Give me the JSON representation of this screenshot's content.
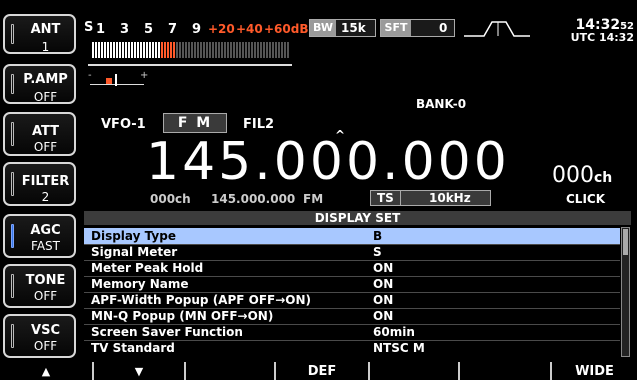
{
  "side_buttons": [
    {
      "name": "ANT",
      "value": "1",
      "active": false
    },
    {
      "name": "P.AMP",
      "value": "OFF",
      "active": false
    },
    {
      "name": "ATT",
      "value": "OFF",
      "active": false
    },
    {
      "name": "FILTER",
      "value": "2",
      "active": false
    },
    {
      "name": "AGC",
      "value": "FAST",
      "active": true
    },
    {
      "name": "TONE",
      "value": "OFF",
      "active": false
    },
    {
      "name": "VSC",
      "value": "OFF",
      "active": false
    }
  ],
  "meter": {
    "s_label": "S",
    "scale": [
      "1",
      "3",
      "5",
      "7",
      "9"
    ],
    "plus_scale": [
      "+20",
      "+40",
      "+60dB"
    ],
    "peak_level": 0.42
  },
  "bw": {
    "label": "BW",
    "value": "15k"
  },
  "sft": {
    "label": "SFT",
    "value": "0"
  },
  "clock": {
    "time": "14:32",
    "seconds": "52",
    "utc": "UTC 14:32"
  },
  "bank": "BANK-0",
  "vfo": "VFO-1",
  "mode": "F M",
  "filter": "FIL2",
  "frequency": "145.000.000",
  "channel": {
    "number": "000",
    "unit": "ch"
  },
  "sub_info": {
    "ch": "000ch",
    "freq": "145.000.000",
    "mode": "FM"
  },
  "ts": {
    "label": "TS",
    "value": "10kHz"
  },
  "click": "CLICK",
  "display_set": {
    "title": "DISPLAY SET",
    "rows": [
      {
        "label": "Display Type",
        "value": "B",
        "selected": true
      },
      {
        "label": "Signal Meter",
        "value": "S",
        "selected": false
      },
      {
        "label": "Meter Peak Hold",
        "value": "ON",
        "selected": false
      },
      {
        "label": "Memory Name",
        "value": "ON",
        "selected": false
      },
      {
        "label": "APF-Width Popup (APF OFF→ON)",
        "value": "ON",
        "selected": false
      },
      {
        "label": "MN-Q Popup (MN OFF→ON)",
        "value": "ON",
        "selected": false
      },
      {
        "label": "Screen Saver Function",
        "value": "60min",
        "selected": false
      },
      {
        "label": "TV Standard",
        "value": "NTSC M",
        "selected": false
      }
    ]
  },
  "bottom_keys": [
    "▲",
    "▼",
    "",
    "DEF",
    "",
    "",
    "WIDE"
  ],
  "colors": {
    "highlight": "#a8c8ff",
    "meter_red": "#ff5a2a",
    "agc_led": "#3a78e8"
  }
}
